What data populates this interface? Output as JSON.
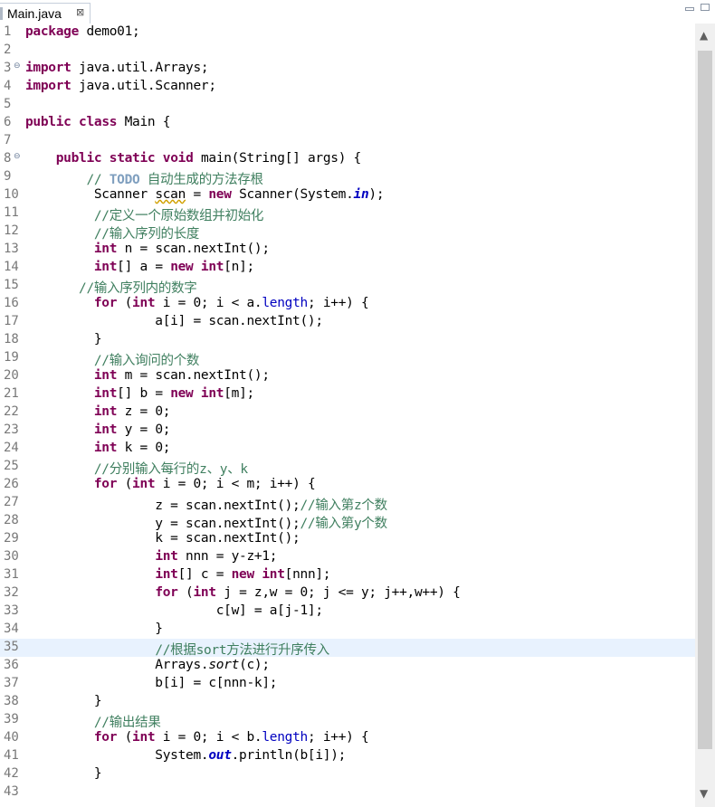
{
  "tab": {
    "title": "Main.java",
    "close": "⊠"
  },
  "window": {
    "minimize": "▭",
    "maximize": "▢"
  },
  "code_lines": [
    {
      "n": "1",
      "tokens": [
        {
          "t": "package",
          "c": "kw"
        },
        {
          "t": " demo01;"
        }
      ]
    },
    {
      "n": "2",
      "tokens": []
    },
    {
      "n": "3",
      "fold": true,
      "tokens": [
        {
          "t": "import",
          "c": "kw"
        },
        {
          "t": " java.util.Arrays;"
        }
      ]
    },
    {
      "n": "4",
      "tokens": [
        {
          "t": "import",
          "c": "kw"
        },
        {
          "t": " java.util.Scanner;"
        }
      ]
    },
    {
      "n": "5",
      "tokens": []
    },
    {
      "n": "6",
      "tokens": [
        {
          "t": "public",
          "c": "kw"
        },
        {
          "t": " "
        },
        {
          "t": "class",
          "c": "kw"
        },
        {
          "t": " Main {"
        }
      ]
    },
    {
      "n": "7",
      "tokens": []
    },
    {
      "n": "8",
      "fold": true,
      "tokens": [
        {
          "t": "    "
        },
        {
          "t": "public",
          "c": "kw"
        },
        {
          "t": " "
        },
        {
          "t": "static",
          "c": "kw"
        },
        {
          "t": " "
        },
        {
          "t": "void",
          "c": "kw"
        },
        {
          "t": " main(String[] args) {"
        }
      ]
    },
    {
      "n": "9",
      "tokens": [
        {
          "t": "        "
        },
        {
          "t": "// ",
          "c": "cm"
        },
        {
          "t": "TODO",
          "c": "todo"
        },
        {
          "t": " 自动生成的方法存根",
          "c": "cm"
        }
      ]
    },
    {
      "n": "10",
      "tokens": [
        {
          "t": "         Scanner "
        },
        {
          "t": "scan",
          "c": "warn"
        },
        {
          "t": " = "
        },
        {
          "t": "new",
          "c": "kw"
        },
        {
          "t": " Scanner(System."
        },
        {
          "t": "in",
          "c": "sf"
        },
        {
          "t": ");"
        }
      ]
    },
    {
      "n": "11",
      "tokens": [
        {
          "t": "         "
        },
        {
          "t": "//定义一个原始数组并初始化",
          "c": "cm"
        }
      ]
    },
    {
      "n": "12",
      "tokens": [
        {
          "t": "         "
        },
        {
          "t": "//输入序列的长度",
          "c": "cm"
        }
      ]
    },
    {
      "n": "13",
      "tokens": [
        {
          "t": "         "
        },
        {
          "t": "int",
          "c": "kw"
        },
        {
          "t": " n = scan.nextInt();"
        }
      ]
    },
    {
      "n": "14",
      "tokens": [
        {
          "t": "         "
        },
        {
          "t": "int",
          "c": "kw"
        },
        {
          "t": "[] a = "
        },
        {
          "t": "new",
          "c": "kw"
        },
        {
          "t": " "
        },
        {
          "t": "int",
          "c": "kw"
        },
        {
          "t": "[n];"
        }
      ]
    },
    {
      "n": "15",
      "tokens": [
        {
          "t": "       "
        },
        {
          "t": "//输入序列内的数字",
          "c": "cm"
        }
      ]
    },
    {
      "n": "16",
      "tokens": [
        {
          "t": "         "
        },
        {
          "t": "for",
          "c": "kw"
        },
        {
          "t": " ("
        },
        {
          "t": "int",
          "c": "kw"
        },
        {
          "t": " i = 0; i < a."
        },
        {
          "t": "length",
          "c": "fld"
        },
        {
          "t": "; i++) {"
        }
      ]
    },
    {
      "n": "17",
      "tokens": [
        {
          "t": "                 a[i] = scan.nextInt();"
        }
      ]
    },
    {
      "n": "18",
      "tokens": [
        {
          "t": "         }"
        }
      ]
    },
    {
      "n": "19",
      "tokens": [
        {
          "t": "         "
        },
        {
          "t": "//输入询问的个数",
          "c": "cm"
        }
      ]
    },
    {
      "n": "20",
      "tokens": [
        {
          "t": "         "
        },
        {
          "t": "int",
          "c": "kw"
        },
        {
          "t": " m = scan.nextInt();"
        }
      ]
    },
    {
      "n": "21",
      "tokens": [
        {
          "t": "         "
        },
        {
          "t": "int",
          "c": "kw"
        },
        {
          "t": "[] b = "
        },
        {
          "t": "new",
          "c": "kw"
        },
        {
          "t": " "
        },
        {
          "t": "int",
          "c": "kw"
        },
        {
          "t": "[m];"
        }
      ]
    },
    {
      "n": "22",
      "tokens": [
        {
          "t": "         "
        },
        {
          "t": "int",
          "c": "kw"
        },
        {
          "t": " z = 0;"
        }
      ]
    },
    {
      "n": "23",
      "tokens": [
        {
          "t": "         "
        },
        {
          "t": "int",
          "c": "kw"
        },
        {
          "t": " y = 0;"
        }
      ]
    },
    {
      "n": "24",
      "tokens": [
        {
          "t": "         "
        },
        {
          "t": "int",
          "c": "kw"
        },
        {
          "t": " k = 0;"
        }
      ]
    },
    {
      "n": "25",
      "tokens": [
        {
          "t": "         "
        },
        {
          "t": "//分别输入每行的z、y、k",
          "c": "cm"
        }
      ]
    },
    {
      "n": "26",
      "tokens": [
        {
          "t": "         "
        },
        {
          "t": "for",
          "c": "kw"
        },
        {
          "t": " ("
        },
        {
          "t": "int",
          "c": "kw"
        },
        {
          "t": " i = 0; i < m; i++) {"
        }
      ]
    },
    {
      "n": "27",
      "tokens": [
        {
          "t": "                 z = scan.nextInt();"
        },
        {
          "t": "//输入第z个数",
          "c": "cm"
        }
      ]
    },
    {
      "n": "28",
      "tokens": [
        {
          "t": "                 y = scan.nextInt();"
        },
        {
          "t": "//输入第y个数",
          "c": "cm"
        }
      ]
    },
    {
      "n": "29",
      "tokens": [
        {
          "t": "                 k = scan.nextInt();"
        }
      ]
    },
    {
      "n": "30",
      "tokens": [
        {
          "t": "                 "
        },
        {
          "t": "int",
          "c": "kw"
        },
        {
          "t": " nnn = y-z+1;"
        }
      ]
    },
    {
      "n": "31",
      "tokens": [
        {
          "t": "                 "
        },
        {
          "t": "int",
          "c": "kw"
        },
        {
          "t": "[] c = "
        },
        {
          "t": "new",
          "c": "kw"
        },
        {
          "t": " "
        },
        {
          "t": "int",
          "c": "kw"
        },
        {
          "t": "[nnn];"
        }
      ]
    },
    {
      "n": "32",
      "tokens": [
        {
          "t": "                 "
        },
        {
          "t": "for",
          "c": "kw"
        },
        {
          "t": " ("
        },
        {
          "t": "int",
          "c": "kw"
        },
        {
          "t": " j = z,w = 0; j <= y; j++,w++) {"
        }
      ]
    },
    {
      "n": "33",
      "tokens": [
        {
          "t": "                         c[w] = a[j-1];"
        }
      ]
    },
    {
      "n": "34",
      "tokens": [
        {
          "t": "                 }"
        }
      ]
    },
    {
      "n": "35",
      "current": true,
      "tokens": [
        {
          "t": "                 "
        },
        {
          "t": "//根据sort方法进行升序传入",
          "c": "cm"
        }
      ]
    },
    {
      "n": "36",
      "tokens": [
        {
          "t": "                 Arrays."
        },
        {
          "t": "sort",
          "c": "it"
        },
        {
          "t": "(c);"
        }
      ]
    },
    {
      "n": "37",
      "tokens": [
        {
          "t": "                 b[i] = c[nnn-k];"
        }
      ]
    },
    {
      "n": "38",
      "tokens": [
        {
          "t": "         }"
        }
      ]
    },
    {
      "n": "39",
      "tokens": [
        {
          "t": "         "
        },
        {
          "t": "//输出结果",
          "c": "cm"
        }
      ]
    },
    {
      "n": "40",
      "tokens": [
        {
          "t": "         "
        },
        {
          "t": "for",
          "c": "kw"
        },
        {
          "t": " ("
        },
        {
          "t": "int",
          "c": "kw"
        },
        {
          "t": " i = 0; i < b."
        },
        {
          "t": "length",
          "c": "fld"
        },
        {
          "t": "; i++) {"
        }
      ]
    },
    {
      "n": "41",
      "tokens": [
        {
          "t": "                 System."
        },
        {
          "t": "out",
          "c": "sf"
        },
        {
          "t": ".println(b[i]);"
        }
      ]
    },
    {
      "n": "42",
      "tokens": [
        {
          "t": "         }"
        }
      ]
    },
    {
      "n": "43",
      "tokens": []
    }
  ],
  "scrollbar": {
    "up": "▲",
    "down": "▼"
  }
}
